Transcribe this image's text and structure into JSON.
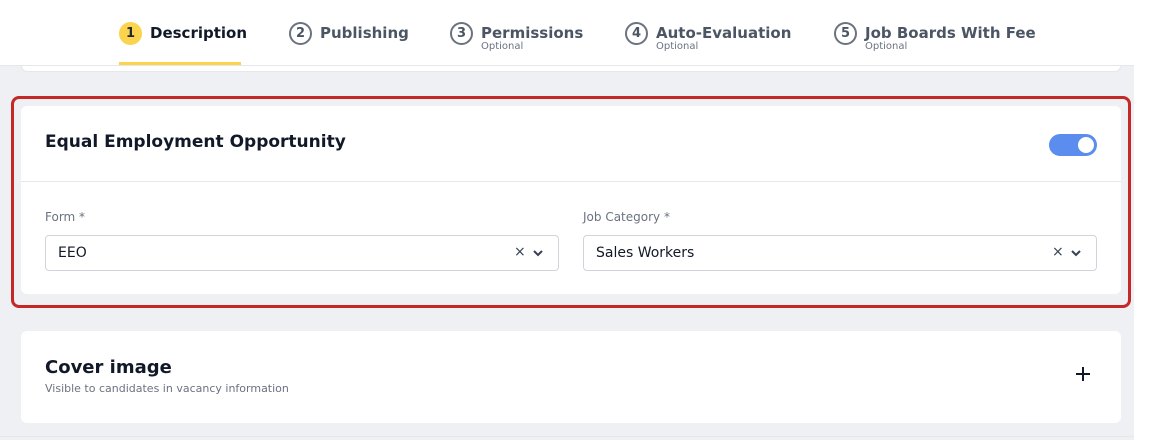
{
  "stepper": {
    "steps": [
      {
        "num": "1",
        "label": "Description",
        "sub": ""
      },
      {
        "num": "2",
        "label": "Publishing",
        "sub": ""
      },
      {
        "num": "3",
        "label": "Permissions",
        "sub": "Optional"
      },
      {
        "num": "4",
        "label": "Auto-Evaluation",
        "sub": "Optional"
      },
      {
        "num": "5",
        "label": "Job Boards With Fee",
        "sub": "Optional"
      }
    ],
    "active_index": 0
  },
  "eeo": {
    "title": "Equal Employment Opportunity",
    "enabled": true,
    "form_label": "Form *",
    "form_value": "EEO",
    "category_label": "Job Category *",
    "category_value": "Sales Workers",
    "clear_glyph": "×"
  },
  "cover": {
    "title": "Cover image",
    "subtitle": "Visible to candidates in vacancy information"
  },
  "colors": {
    "accent_yellow": "#fcd34d",
    "toggle_blue": "#5b8dee",
    "highlight_red": "#c62828"
  }
}
